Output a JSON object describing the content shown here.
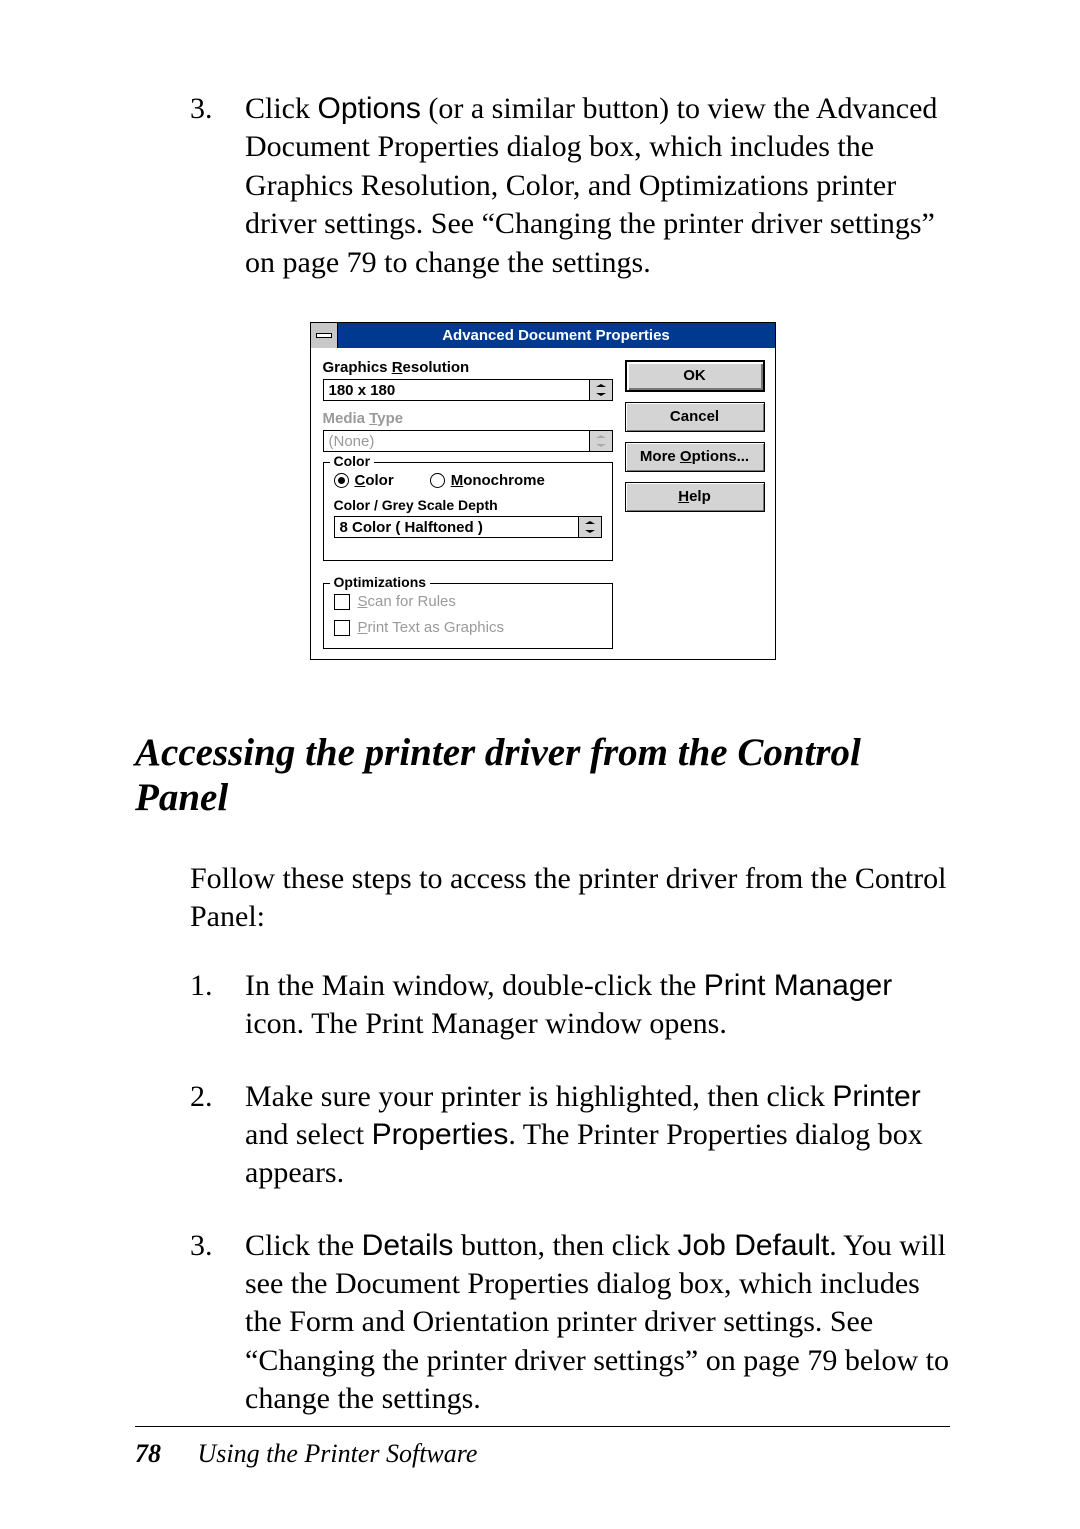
{
  "body": {
    "item3_num": "3.",
    "item3_text_a": "Click ",
    "item3_text_options": "Options",
    "item3_text_b": " (or a similar button) to view the Advanced Document Properties dialog box, which includes the Graphics Resolution, Color, and Optimizations printer driver settings. See “Changing the printer driver settings” on page 79 to change the settings."
  },
  "dialog": {
    "title": "Advanced Document Properties",
    "graphics_res_label_pre": "Graphics ",
    "graphics_res_label_u": "R",
    "graphics_res_label_post": "esolution",
    "graphics_res_value": "180 x 180",
    "media_type_label_pre": "Media ",
    "media_type_label_u": "T",
    "media_type_label_post": "ype",
    "media_type_value": "(None)",
    "color_legend": "Color",
    "radio_color_u": "C",
    "radio_color_post": "olor",
    "radio_mono_u": "M",
    "radio_mono_post": "onochrome",
    "depth_label": "Color / Grey Scale Depth",
    "depth_value": "8 Color ( Halftoned )",
    "optim_legend": "Optimizations",
    "opt_scan_u": "S",
    "opt_scan_post": "can for Rules",
    "opt_print_u": "P",
    "opt_print_post": "rint Text as Graphics",
    "btn_ok": "OK",
    "btn_cancel": "Cancel",
    "btn_more_pre": "More ",
    "btn_more_u": "O",
    "btn_more_post": "ptions...",
    "btn_help_u": "H",
    "btn_help_post": "elp"
  },
  "section": {
    "heading": "Accessing the printer driver from the Control Panel",
    "intro": "Follow these steps to access the printer driver from the Control Panel:",
    "step1_num": "1.",
    "step1_a": "In the Main window, double-click the ",
    "step1_pm": "Print Manager",
    "step1_b": " icon. The Print Manager window opens.",
    "step2_num": "2.",
    "step2_a": "Make sure your printer is highlighted, then click ",
    "step2_printer": "Printer",
    "step2_b": " and select ",
    "step2_props": "Properties",
    "step2_c": ". The Printer Properties dialog box appears.",
    "step3_num": "3.",
    "step3_a": "Click the ",
    "step3_details": "Details",
    "step3_b": " button, then click ",
    "step3_jobdef": "Job Default",
    "step3_c": ". You will see the Document Properties dialog box, which includes the Form and Orientation printer driver settings. See “Changing the printer driver settings” on page 79 below to change the settings."
  },
  "footer": {
    "page_number": "78",
    "chapter": "Using the Printer Software"
  }
}
